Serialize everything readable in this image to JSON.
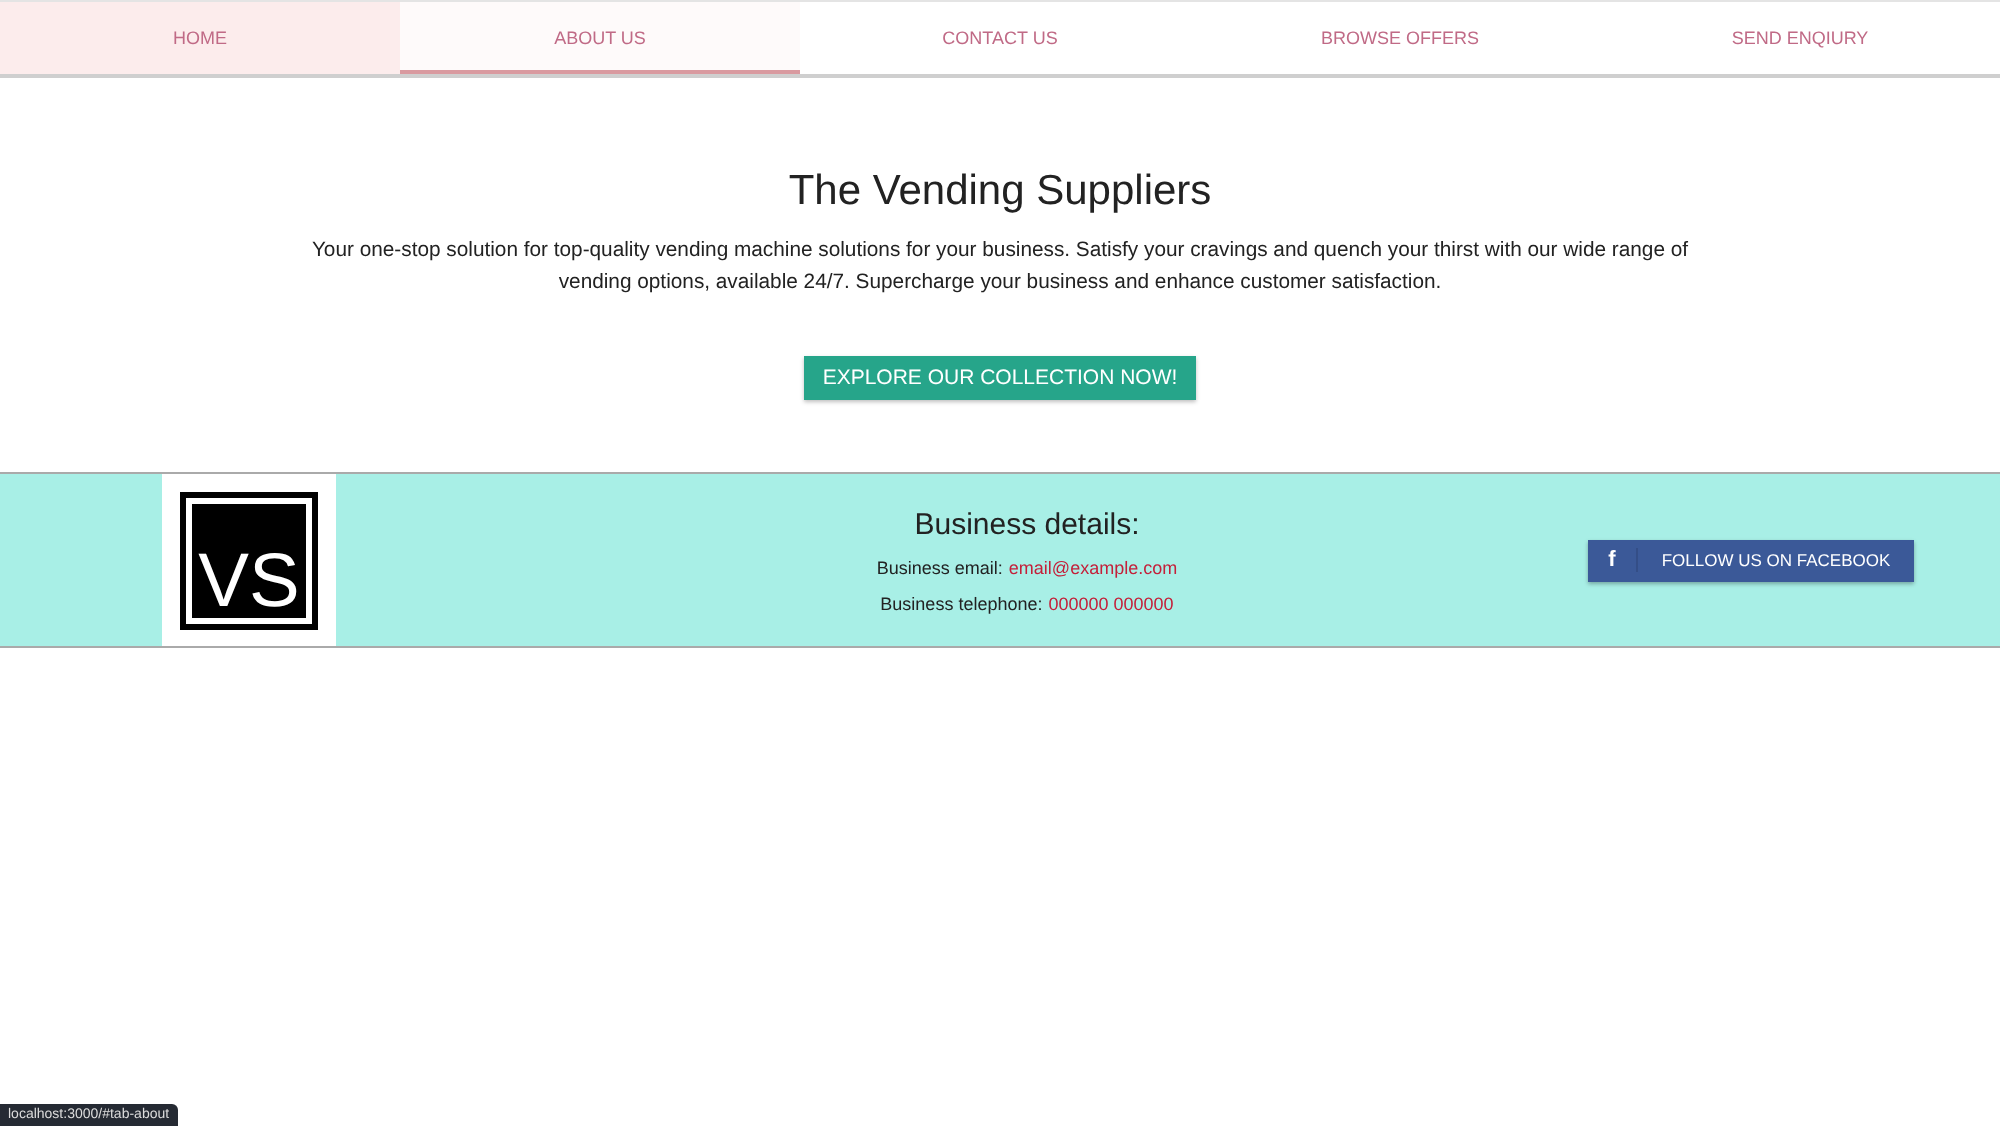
{
  "tabs": [
    {
      "label": "HOME",
      "selected": false,
      "highlighted": true
    },
    {
      "label": "ABOUT US",
      "selected": true,
      "highlighted": false
    },
    {
      "label": "CONTACT US",
      "selected": false,
      "highlighted": false
    },
    {
      "label": "BROWSE OFFERS",
      "selected": false,
      "highlighted": false
    },
    {
      "label": "SEND ENQIURY",
      "selected": false,
      "highlighted": false
    }
  ],
  "hero": {
    "title": "The Vending Suppliers",
    "text": "Your one-stop solution for top-quality vending machine solutions for your business. Satisfy your cravings and quench your thirst with our wide range of vending options, available 24/7. Supercharge your business and enhance customer satisfaction.",
    "button": "EXPLORE OUR COLLECTION NOW!"
  },
  "footer": {
    "logo": "VS",
    "heading": "Business details:",
    "email_label": "Business email:",
    "email": "email@example.com",
    "phone_label": "Business telephone:",
    "phone": "000000 000000",
    "facebook_icon": "f",
    "facebook_button": "FOLLOW US ON FACEBOOK"
  },
  "status_url": "localhost:3000/#tab-about"
}
